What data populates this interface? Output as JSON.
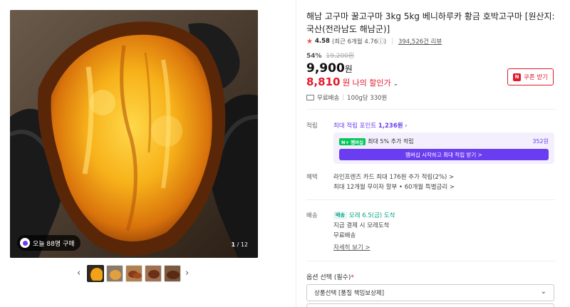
{
  "product": {
    "title": "해남 고구마 꿀고구마 3kg 5kg 베니하루카 황금 호박고구마 [원산지: 국산(전라남도 해남군)]",
    "rating": "4.58",
    "rating_recent": "(최근 6개월 4.76ⓘ)",
    "review_count": "394,526건 리뷰",
    "discount_pct": "54%",
    "original_price": "19,200원",
    "price": "9,900",
    "price_unit": "원",
    "my_price": "8,810",
    "my_price_unit": "원",
    "my_price_label": "나의 할인가",
    "coupon_label": "쿠폰 받기",
    "coupon_icon": "N",
    "shipping": "무료배송",
    "unit_price": "100g당 330원"
  },
  "gallery": {
    "buy_badge": "오늘 88명 구매",
    "counter_current": "1",
    "counter_total": "/ 12",
    "thumb_count": 5
  },
  "points": {
    "label": "적립",
    "link_prefix": "최대 적립 포인트",
    "link_amount": "1,236원",
    "member_tag": "N+ 멤버십",
    "member_text": "최대 5% 추가 적립",
    "member_amount": "352원",
    "member_button": "멤버십 시작하고 최대 적립 받기 >"
  },
  "benefits": {
    "label": "혜택",
    "line1": "라인프렌즈 카드 최대 176원 추가 적립(2%) >",
    "line2": "최대 12개월 무이자 할부 • 60개월 특별금리 >"
  },
  "delivery": {
    "label": "배송",
    "tag": "배송",
    "arrival": "모레 6.5(금) 도착",
    "line2": "지금 결제 시 모레도착",
    "line3": "무료배송",
    "detail_link": "자세히 보기 >"
  },
  "options": {
    "label": "옵션 선택 (필수)",
    "required_mark": "*",
    "select_value": "상품선택 [품질 책임보상제]"
  },
  "colors": {
    "accent_red": "#e4192b",
    "accent_purple": "#6a3df0",
    "naver_green": "#03c75a",
    "teal": "#08a58b"
  },
  "icons": {
    "star": "star-icon",
    "truck": "truck-icon",
    "chevron_down": "chevron-down-icon",
    "arrow_left": "arrow-left-icon",
    "arrow_right": "arrow-right-icon"
  }
}
